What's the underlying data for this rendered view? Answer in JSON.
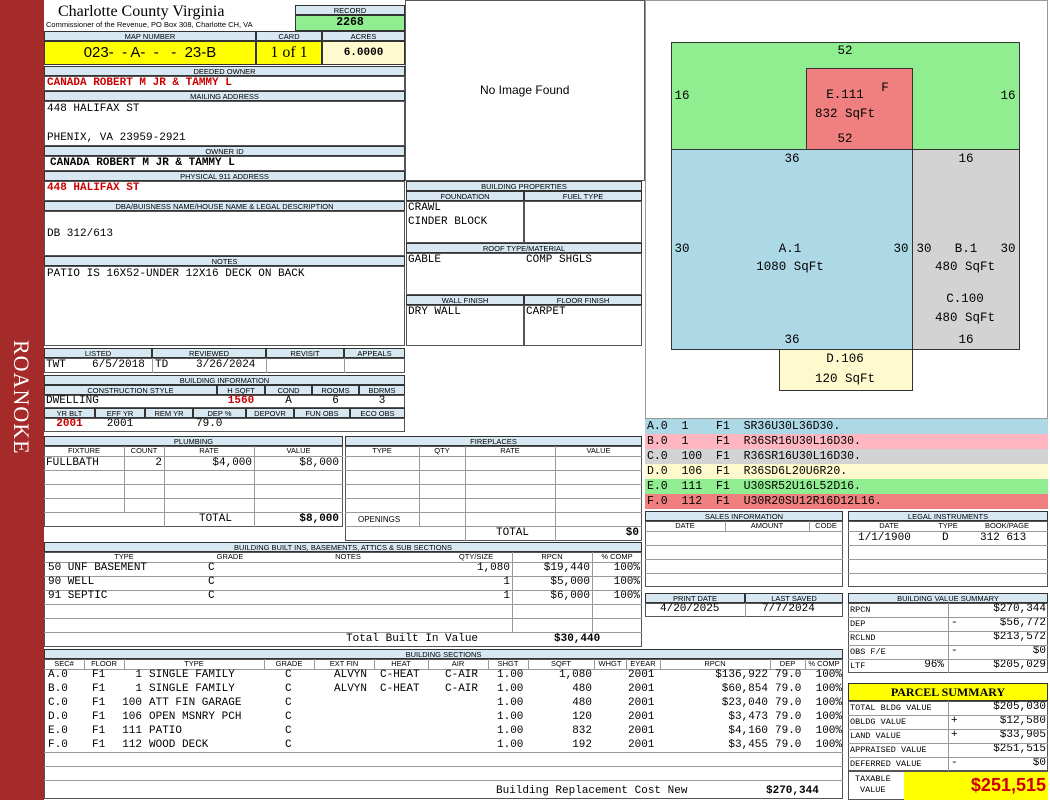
{
  "sidebar": {
    "label": "ROANOKE"
  },
  "header": {
    "county": "Charlotte County Virginia",
    "office": "Commissioner of the Revenue, PO Box 308, Charlotte CH, VA",
    "record_label": "RECORD",
    "record": "2268",
    "map_label": "MAP NUMBER",
    "map_number": "023-  - A-  -   -  23-B",
    "card_label": "CARD",
    "card": "1 of 1",
    "acres_label": "ACRES",
    "acres": "6.0000"
  },
  "owner": {
    "deeded_label": "DEEDED OWNER",
    "deeded": "CANADA ROBERT M JR & TAMMY L",
    "mailing_label": "MAILING ADDRESS",
    "addr1": "448 HALIFAX ST",
    "addr2": "PHENIX, VA 23959-2921",
    "id_label": "OWNER ID",
    "owner_id": "CANADA ROBERT M JR & TAMMY L",
    "phys_label": "PHYSICAL 911 ADDRESS",
    "physical": "448 HALIFAX ST",
    "dba_label": "DBA/BUISNESS NAME/HOUSE NAME & LEGAL DESCRIPTION",
    "dba": "DB 312/613",
    "notes_label": "NOTES",
    "notes": "PATIO IS 16X52-UNDER 12X16 DECK ON BACK"
  },
  "photo": {
    "text": "No Image Found"
  },
  "review": {
    "h_listed": "LISTED",
    "h_reviewed": "REVIEWED",
    "h_revisit": "REVISIT",
    "h_appeals": "APPEALS",
    "listed_by": "TWT",
    "listed": "6/5/2018",
    "reviewed_by": "TD",
    "reviewed": "3/26/2024"
  },
  "building_info": {
    "title": "BUILDING INFORMATION",
    "h_style": "CONSTRUCTION STYLE",
    "h_hsqft": "H SQFT",
    "h_cond": "COND",
    "h_rooms": "ROOMS",
    "h_bdrms": "BDRMS",
    "style": "DWELLING",
    "hsqft": "1560",
    "cond": "A",
    "rooms": "6",
    "bdrms": "3",
    "h_yrblt": "YR BLT",
    "h_effyr": "EFF YR",
    "h_remyr": "REM YR",
    "h_dep": "DEP %",
    "h_depovr": "DEPOVR",
    "h_funobs": "FUN OBS",
    "h_ecoobs": "ECO OBS",
    "yrblt": "2001",
    "effyr": "2001",
    "dep": "79.0"
  },
  "building_props": {
    "title": "BUILDING PROPERTIES",
    "h_foundation": "FOUNDATION",
    "h_fuel": "FUEL TYPE",
    "foundation1": "CRAWL",
    "foundation2": "CINDER BLOCK",
    "h_roof": "ROOF TYPE/MATERIAL",
    "roof_type": "GABLE",
    "roof_mat": "COMP SHGLS",
    "h_wall": "WALL FINISH",
    "h_floor": "FLOOR FINISH",
    "wall": "DRY WALL",
    "floor": "CARPET"
  },
  "sketch": {
    "top": "52",
    "g_left": "16",
    "g_right": "16",
    "e_name": "E.111",
    "e_flag": "F",
    "e_area": "832 SqFt",
    "e_bottom": "52",
    "a_top": "36",
    "b_top": "16",
    "a_left": "30",
    "a_right": "30",
    "a_name": "A.1",
    "a_area": "1080 SqFt",
    "b_left": "30",
    "b_right": "30",
    "b_name": "B.1",
    "b_area": "480 SqFt",
    "c_name": "C.100",
    "c_area": "480 SqFt",
    "a_bottom": "36",
    "c_bottom": "16",
    "d_name": "D.106",
    "d_area": "120 SqFt",
    "colors": {
      "green": "#90ee90",
      "red": "#f08080",
      "blue": "#add8e6",
      "gray": "#d3d3d3",
      "yellow": "#fffacd"
    }
  },
  "legend": [
    {
      "text": "A.0  1    F1  SR36U30L36D30.",
      "color": "#add8e6"
    },
    {
      "text": "B.0  1    F1  R36SR16U30L16D30.",
      "color": "#ffb6c1"
    },
    {
      "text": "C.0  100  F1  R36SR16U30L16D30.",
      "color": "#d3d3d3"
    },
    {
      "text": "D.0  106  F1  R36SD6L20U6R20.",
      "color": "#fffacd"
    },
    {
      "text": "E.0  111  F1  U30SR52U16L52D16.",
      "color": "#90ee90"
    },
    {
      "text": "F.0  112  F1  U30R20SU12R16D12L16.",
      "color": "#f08080"
    }
  ],
  "plumbing": {
    "title": "PLUMBING",
    "h_fixture": "FIXTURE",
    "h_count": "COUNT",
    "h_rate": "RATE",
    "h_value": "VALUE",
    "fixture": "FULLBATH",
    "count": "2",
    "rate": "$4,000",
    "value": "$8,000",
    "total_label": "TOTAL",
    "total": "$8,000"
  },
  "fireplaces": {
    "title": "FIREPLACES",
    "h_type": "TYPE",
    "h_qty": "QTY",
    "h_rate": "RATE",
    "h_value": "VALUE",
    "openings": "OPENINGS",
    "total_label": "TOTAL",
    "total": "$0"
  },
  "sales": {
    "title": "SALES INFORMATION",
    "h_date": "DATE",
    "h_amount": "AMOUNT",
    "h_code": "CODE"
  },
  "legal": {
    "title": "LEGAL INSTRUMENTS",
    "h_date": "DATE",
    "h_type": "TYPE",
    "h_book": "BOOK/PAGE",
    "date": "1/1/1900",
    "type": "D",
    "book": "312 613"
  },
  "builtins": {
    "title": "BUILDING BUILT INS, BASEMENTS, ATTICS & SUB SECTIONS",
    "h_type": "TYPE",
    "h_grade": "GRADE",
    "h_notes": "NOTES",
    "h_qty": "QTY/SIZE",
    "h_rpcn": "RPCN",
    "h_comp": "% COMP",
    "rows": [
      {
        "type": "50 UNF BASEMENT",
        "grade": "C",
        "qty": "1,080",
        "rpcn": "$19,440",
        "comp": "100%"
      },
      {
        "type": "90 WELL",
        "grade": "C",
        "qty": "1",
        "rpcn": "$5,000",
        "comp": "100%"
      },
      {
        "type": "91 SEPTIC",
        "grade": "C",
        "qty": "1",
        "rpcn": "$6,000",
        "comp": "100%"
      }
    ],
    "total_label": "Total Built In Value",
    "total": "$30,440"
  },
  "dates": {
    "h_print": "PRINT DATE",
    "h_saved": "LAST SAVED",
    "print": "4/20/2025",
    "saved": "7/7/2024"
  },
  "value_summary": {
    "title": "BUILDING VALUE SUMMARY",
    "rows": [
      {
        "label": "RPCN",
        "sign": "",
        "pct": "",
        "value": "$270,344"
      },
      {
        "label": "DEP",
        "sign": "-",
        "pct": "",
        "value": "$56,772"
      },
      {
        "label": "RCLND",
        "sign": "",
        "pct": "",
        "value": "$213,572"
      },
      {
        "label": "OBS F/E",
        "sign": "-",
        "pct": "",
        "value": "$0"
      },
      {
        "label": "LTF",
        "sign": "",
        "pct": "96%",
        "value": "$205,029"
      }
    ]
  },
  "parcel": {
    "title": "PARCEL SUMMARY",
    "rows": [
      {
        "label": "TOTAL BLDG VALUE",
        "sign": "",
        "value": "$205,030"
      },
      {
        "label": "OBLDG VALUE",
        "sign": "+",
        "value": "$12,580"
      },
      {
        "label": "LAND VALUE",
        "sign": "+",
        "value": "$33,905"
      },
      {
        "label": "APPRAISED VALUE",
        "sign": "",
        "value": "$251,515"
      },
      {
        "label": "DEFERRED VALUE",
        "sign": "-",
        "value": "$0"
      }
    ],
    "taxable_label1": "TAXABLE",
    "taxable_label2": "VALUE",
    "taxable": "$251,515"
  },
  "sections": {
    "title": "BUILDING SECTIONS",
    "h_sec": "SEC#",
    "h_floor": "FLOOR",
    "h_type": "TYPE",
    "h_grade": "GRADE",
    "h_extfin": "EXT FIN",
    "h_heat": "HEAT",
    "h_air": "AIR",
    "h_shgt": "SHGT",
    "h_sqft": "SQFT",
    "h_whgt": "WHGT",
    "h_eyear": "EYEAR",
    "h_rpcn": "RPCN",
    "h_dep": "DEP",
    "h_comp": "% COMP",
    "rows": [
      {
        "sec": "A.0",
        "floor": "F1",
        "code": "1",
        "type": "SINGLE FAMILY",
        "grade": "C",
        "ext": "ALVYN",
        "heat": "C-HEAT",
        "air": "C-AIR",
        "shgt": "1.00",
        "sqft": "1,080",
        "eyear": "2001",
        "rpcn": "$136,922",
        "dep": "79.0",
        "comp": "100%"
      },
      {
        "sec": "B.0",
        "floor": "F1",
        "code": "1",
        "type": "SINGLE FAMILY",
        "grade": "C",
        "ext": "ALVYN",
        "heat": "C-HEAT",
        "air": "C-AIR",
        "shgt": "1.00",
        "sqft": "480",
        "eyear": "2001",
        "rpcn": "$60,854",
        "dep": "79.0",
        "comp": "100%"
      },
      {
        "sec": "C.0",
        "floor": "F1",
        "code": "100",
        "type": "ATT FIN GARAGE",
        "grade": "C",
        "ext": "",
        "heat": "",
        "air": "",
        "shgt": "1.00",
        "sqft": "480",
        "eyear": "2001",
        "rpcn": "$23,040",
        "dep": "79.0",
        "comp": "100%"
      },
      {
        "sec": "D.0",
        "floor": "F1",
        "code": "106",
        "type": "OPEN MSNRY PCH",
        "grade": "C",
        "ext": "",
        "heat": "",
        "air": "",
        "shgt": "1.00",
        "sqft": "120",
        "eyear": "2001",
        "rpcn": "$3,473",
        "dep": "79.0",
        "comp": "100%"
      },
      {
        "sec": "E.0",
        "floor": "F1",
        "code": "111",
        "type": "PATIO",
        "grade": "C",
        "ext": "",
        "heat": "",
        "air": "",
        "shgt": "1.00",
        "sqft": "832",
        "eyear": "2001",
        "rpcn": "$4,160",
        "dep": "79.0",
        "comp": "100%"
      },
      {
        "sec": "F.0",
        "floor": "F1",
        "code": "112",
        "type": "WOOD DECK",
        "grade": "C",
        "ext": "",
        "heat": "",
        "air": "",
        "shgt": "1.00",
        "sqft": "192",
        "eyear": "2001",
        "rpcn": "$3,455",
        "dep": "79.0",
        "comp": "100%"
      }
    ],
    "total_label": "Building Replacement Cost New",
    "total": "$270,344"
  }
}
